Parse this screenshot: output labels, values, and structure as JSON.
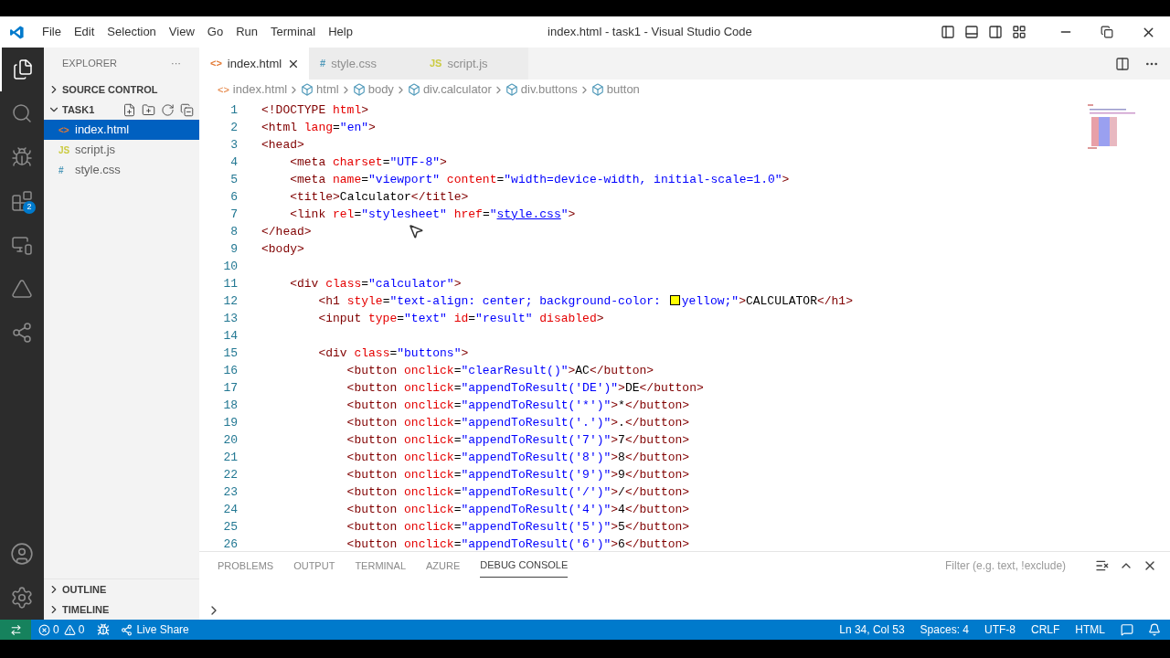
{
  "window": {
    "title": "index.html - task1 - Visual Studio Code"
  },
  "menu": [
    "File",
    "Edit",
    "Selection",
    "View",
    "Go",
    "Run",
    "Terminal",
    "Help"
  ],
  "activity_bar": [
    {
      "kind": "files",
      "selected": true
    },
    {
      "kind": "search",
      "selected": false
    },
    {
      "kind": "debug",
      "selected": false
    },
    {
      "kind": "extensions",
      "selected": false,
      "badge": "2"
    },
    {
      "kind": "remote",
      "selected": false
    },
    {
      "kind": "azure",
      "selected": false
    },
    {
      "kind": "liveshare",
      "selected": false
    }
  ],
  "sidebar": {
    "title": "EXPLORER",
    "more": "···",
    "sections": [
      {
        "label": "SOURCE CONTROL",
        "expanded": false
      },
      {
        "label": "TASK1",
        "expanded": true,
        "children": [
          {
            "icon": "<>",
            "kind": "html",
            "label": "index.html",
            "selected": true
          },
          {
            "icon": "JS",
            "kind": "js",
            "label": "script.js",
            "selected": false
          },
          {
            "icon": "#",
            "kind": "css",
            "label": "style.css",
            "selected": false
          }
        ]
      }
    ],
    "bottom_sections": [
      {
        "label": "OUTLINE",
        "expanded": false
      },
      {
        "label": "TIMELINE",
        "expanded": false
      }
    ]
  },
  "tabs": [
    {
      "icon": "<>",
      "kind": "html",
      "label": "index.html",
      "selected": true
    },
    {
      "icon": "#",
      "kind": "css",
      "label": "style.css",
      "selected": false
    },
    {
      "icon": "JS",
      "kind": "js",
      "label": "script.js",
      "selected": false
    }
  ],
  "breadcrumb": [
    {
      "label": "index.html",
      "kind": "file"
    },
    {
      "label": "html",
      "kind": "element"
    },
    {
      "label": "body",
      "kind": "element"
    },
    {
      "label": "div.calculator",
      "kind": "element"
    },
    {
      "label": "div.buttons",
      "kind": "element"
    },
    {
      "label": "button",
      "kind": "element"
    }
  ],
  "code": [
    {
      "n": "1",
      "tokens": [
        {
          "kind": "tag",
          "t": "<!DOCTYPE"
        },
        {
          "kind": "attr",
          "t": " html"
        },
        {
          "kind": "tag",
          "t": ">"
        }
      ]
    },
    {
      "n": "2",
      "tokens": [
        {
          "kind": "tag",
          "t": "<html"
        },
        {
          "kind": "attr",
          "t": " lang"
        },
        {
          "kind": "text",
          "t": "="
        },
        {
          "kind": "str",
          "t": "\"en\""
        },
        {
          "kind": "tag",
          "t": ">"
        }
      ]
    },
    {
      "n": "3",
      "tokens": [
        {
          "kind": "tag",
          "t": "<head>"
        }
      ]
    },
    {
      "n": "4",
      "tokens": [
        {
          "kind": "tag",
          "t": "    <meta"
        },
        {
          "kind": "attr",
          "t": " charset"
        },
        {
          "kind": "text",
          "t": "="
        },
        {
          "kind": "str",
          "t": "\"UTF-8\""
        },
        {
          "kind": "tag",
          "t": ">"
        }
      ]
    },
    {
      "n": "5",
      "tokens": [
        {
          "kind": "tag",
          "t": "    <meta"
        },
        {
          "kind": "attr",
          "t": " name"
        },
        {
          "kind": "text",
          "t": "="
        },
        {
          "kind": "str",
          "t": "\"viewport\""
        },
        {
          "kind": "attr",
          "t": " content"
        },
        {
          "kind": "text",
          "t": "="
        },
        {
          "kind": "str",
          "t": "\"width=device-width, initial-scale=1.0\""
        },
        {
          "kind": "tag",
          "t": ">"
        }
      ]
    },
    {
      "n": "6",
      "tokens": [
        {
          "kind": "tag",
          "t": "    <title>"
        },
        {
          "kind": "text",
          "t": "Calculator"
        },
        {
          "kind": "tag",
          "t": "</title>"
        }
      ]
    },
    {
      "n": "7",
      "tokens": [
        {
          "kind": "tag",
          "t": "    <link"
        },
        {
          "kind": "attr",
          "t": " rel"
        },
        {
          "kind": "text",
          "t": "="
        },
        {
          "kind": "str",
          "t": "\"stylesheet\""
        },
        {
          "kind": "attr",
          "t": " href"
        },
        {
          "kind": "text",
          "t": "="
        },
        {
          "kind": "str",
          "t": "\""
        },
        {
          "kind": "link",
          "t": "style.css"
        },
        {
          "kind": "str",
          "t": "\""
        },
        {
          "kind": "tag",
          "t": ">"
        }
      ]
    },
    {
      "n": "8",
      "tokens": [
        {
          "kind": "tag",
          "t": "</head>"
        }
      ]
    },
    {
      "n": "9",
      "tokens": [
        {
          "kind": "tag",
          "t": "<body>"
        }
      ]
    },
    {
      "n": "10"
    },
    {
      "n": "11",
      "tokens": [
        {
          "kind": "tag",
          "t": "    <div"
        },
        {
          "kind": "attr",
          "t": " class"
        },
        {
          "kind": "text",
          "t": "="
        },
        {
          "kind": "str",
          "t": "\"calculator\""
        },
        {
          "kind": "tag",
          "t": ">"
        }
      ]
    },
    {
      "n": "12",
      "tokens": [
        {
          "kind": "tag",
          "t": "        <h1"
        },
        {
          "kind": "attr",
          "t": " style"
        },
        {
          "kind": "text",
          "t": "="
        },
        {
          "kind": "str",
          "t": "\"text-align: center; background-color: "
        },
        {
          "kind": "swatch",
          "color": "#ffff00"
        },
        {
          "kind": "str",
          "t": "yellow;\""
        },
        {
          "kind": "tag",
          "t": ">"
        },
        {
          "kind": "text",
          "t": "CALCULATOR"
        },
        {
          "kind": "tag",
          "t": "</h1>"
        }
      ]
    },
    {
      "n": "13",
      "tokens": [
        {
          "kind": "tag",
          "t": "        <input"
        },
        {
          "kind": "attr",
          "t": " type"
        },
        {
          "kind": "text",
          "t": "="
        },
        {
          "kind": "str",
          "t": "\"text\""
        },
        {
          "kind": "attr",
          "t": " id"
        },
        {
          "kind": "text",
          "t": "="
        },
        {
          "kind": "str",
          "t": "\"result\""
        },
        {
          "kind": "attr",
          "t": " disabled"
        },
        {
          "kind": "tag",
          "t": ">"
        }
      ]
    },
    {
      "n": "14"
    },
    {
      "n": "15",
      "tokens": [
        {
          "kind": "tag",
          "t": "        <div"
        },
        {
          "kind": "attr",
          "t": " class"
        },
        {
          "kind": "text",
          "t": "="
        },
        {
          "kind": "str",
          "t": "\"buttons\""
        },
        {
          "kind": "tag",
          "t": ">"
        }
      ]
    },
    {
      "n": "16",
      "tokens": [
        {
          "kind": "tag",
          "t": "            <button"
        },
        {
          "kind": "attr",
          "t": " onclick"
        },
        {
          "kind": "text",
          "t": "="
        },
        {
          "kind": "str",
          "t": "\"clearResult()\""
        },
        {
          "kind": "tag",
          "t": ">"
        },
        {
          "kind": "text",
          "t": "AC"
        },
        {
          "kind": "tag",
          "t": "</button>"
        }
      ]
    },
    {
      "n": "17",
      "tokens": [
        {
          "kind": "tag",
          "t": "            <button"
        },
        {
          "kind": "attr",
          "t": " onclick"
        },
        {
          "kind": "text",
          "t": "="
        },
        {
          "kind": "str",
          "t": "\"appendToResult('DE')\""
        },
        {
          "kind": "tag",
          "t": ">"
        },
        {
          "kind": "text",
          "t": "DE"
        },
        {
          "kind": "tag",
          "t": "</button>"
        }
      ]
    },
    {
      "n": "18",
      "tokens": [
        {
          "kind": "tag",
          "t": "            <button"
        },
        {
          "kind": "attr",
          "t": " onclick"
        },
        {
          "kind": "text",
          "t": "="
        },
        {
          "kind": "str",
          "t": "\"appendToResult('*')\""
        },
        {
          "kind": "tag",
          "t": ">"
        },
        {
          "kind": "text",
          "t": "*"
        },
        {
          "kind": "tag",
          "t": "</button>"
        }
      ]
    },
    {
      "n": "19",
      "tokens": [
        {
          "kind": "tag",
          "t": "            <button"
        },
        {
          "kind": "attr",
          "t": " onclick"
        },
        {
          "kind": "text",
          "t": "="
        },
        {
          "kind": "str",
          "t": "\"appendToResult('.')\""
        },
        {
          "kind": "tag",
          "t": ">"
        },
        {
          "kind": "text",
          "t": "."
        },
        {
          "kind": "tag",
          "t": "</button>"
        }
      ]
    },
    {
      "n": "20",
      "tokens": [
        {
          "kind": "tag",
          "t": "            <button"
        },
        {
          "kind": "attr",
          "t": " onclick"
        },
        {
          "kind": "text",
          "t": "="
        },
        {
          "kind": "str",
          "t": "\"appendToResult('7')\""
        },
        {
          "kind": "tag",
          "t": ">"
        },
        {
          "kind": "text",
          "t": "7"
        },
        {
          "kind": "tag",
          "t": "</button>"
        }
      ]
    },
    {
      "n": "21",
      "tokens": [
        {
          "kind": "tag",
          "t": "            <button"
        },
        {
          "kind": "attr",
          "t": " onclick"
        },
        {
          "kind": "text",
          "t": "="
        },
        {
          "kind": "str",
          "t": "\"appendToResult('8')\""
        },
        {
          "kind": "tag",
          "t": ">"
        },
        {
          "kind": "text",
          "t": "8"
        },
        {
          "kind": "tag",
          "t": "</button>"
        }
      ]
    },
    {
      "n": "22",
      "tokens": [
        {
          "kind": "tag",
          "t": "            <button"
        },
        {
          "kind": "attr",
          "t": " onclick"
        },
        {
          "kind": "text",
          "t": "="
        },
        {
          "kind": "str",
          "t": "\"appendToResult('9')\""
        },
        {
          "kind": "tag",
          "t": ">"
        },
        {
          "kind": "text",
          "t": "9"
        },
        {
          "kind": "tag",
          "t": "</button>"
        }
      ]
    },
    {
      "n": "23",
      "tokens": [
        {
          "kind": "tag",
          "t": "            <button"
        },
        {
          "kind": "attr",
          "t": " onclick"
        },
        {
          "kind": "text",
          "t": "="
        },
        {
          "kind": "str",
          "t": "\"appendToResult('/')\""
        },
        {
          "kind": "tag",
          "t": ">"
        },
        {
          "kind": "text",
          "t": "/"
        },
        {
          "kind": "tag",
          "t": "</button>"
        }
      ]
    },
    {
      "n": "24",
      "tokens": [
        {
          "kind": "tag",
          "t": "            <button"
        },
        {
          "kind": "attr",
          "t": " onclick"
        },
        {
          "kind": "text",
          "t": "="
        },
        {
          "kind": "str",
          "t": "\"appendToResult('4')\""
        },
        {
          "kind": "tag",
          "t": ">"
        },
        {
          "kind": "text",
          "t": "4"
        },
        {
          "kind": "tag",
          "t": "</button>"
        }
      ]
    },
    {
      "n": "25",
      "tokens": [
        {
          "kind": "tag",
          "t": "            <button"
        },
        {
          "kind": "attr",
          "t": " onclick"
        },
        {
          "kind": "text",
          "t": "="
        },
        {
          "kind": "str",
          "t": "\"appendToResult('5')\""
        },
        {
          "kind": "tag",
          "t": ">"
        },
        {
          "kind": "text",
          "t": "5"
        },
        {
          "kind": "tag",
          "t": "</button>"
        }
      ]
    },
    {
      "n": "26",
      "tokens": [
        {
          "kind": "tag",
          "t": "            <button"
        },
        {
          "kind": "attr",
          "t": " onclick"
        },
        {
          "kind": "text",
          "t": "="
        },
        {
          "kind": "str",
          "t": "\"appendToResult('6')\""
        },
        {
          "kind": "tag",
          "t": ">"
        },
        {
          "kind": "text",
          "t": "6"
        },
        {
          "kind": "tag",
          "t": "</button>"
        }
      ]
    }
  ],
  "panel": {
    "tabs": [
      {
        "label": "PROBLEMS",
        "selected": false
      },
      {
        "label": "OUTPUT",
        "selected": false
      },
      {
        "label": "TERMINAL",
        "selected": false
      },
      {
        "label": "AZURE",
        "selected": false
      },
      {
        "label": "DEBUG CONSOLE",
        "selected": true
      }
    ],
    "filter": {
      "placeholder": "Filter (e.g. text, !exclude)"
    }
  },
  "status_bar": {
    "errors": "0",
    "warnings": "0",
    "live_share": "Live Share",
    "right": [
      "Ln 34, Col 53",
      "Spaces: 4",
      "UTF-8",
      "CRLF",
      "HTML"
    ]
  }
}
